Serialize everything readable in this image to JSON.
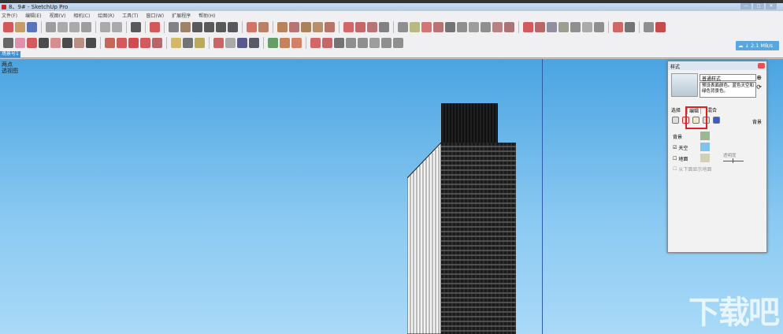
{
  "window": {
    "title": "8、9# - SketchUp Pro",
    "min": "—",
    "max": "◻",
    "close": "✕"
  },
  "menu": [
    "文件(F)",
    "编辑(E)",
    "视图(V)",
    "相机(C)",
    "绘图(R)",
    "工具(T)",
    "窗口(W)",
    "扩展程序",
    "帮助(H)"
  ],
  "toolbar1": [
    "#c33",
    "#b84",
    "#35a",
    "sep",
    "#888",
    "#999",
    "#999",
    "#888",
    "sep",
    "#999",
    "#999",
    "sep",
    "#333",
    "sep",
    "#c33",
    "sep",
    "#666",
    "#864",
    "#333",
    "#333",
    "#333",
    "#333",
    "sep",
    "#c54",
    "#a64",
    "sep",
    "#a63",
    "#a55",
    "#963",
    "#a74",
    "#a54",
    "sep",
    "#c44",
    "#b44",
    "#a55",
    "#666",
    "sep",
    "#777",
    "#aa6",
    "#c55",
    "#a55",
    "#555",
    "#777",
    "#888",
    "#777",
    "#a66",
    "#955",
    "sep",
    "#c33",
    "#a44",
    "#778",
    "#887",
    "#777",
    "#999",
    "#777",
    "sep",
    "#c44",
    "#555",
    "sep",
    "#777",
    "#b22"
  ],
  "toolbar2": [
    "#444",
    "#d79",
    "#c33",
    "#222",
    "#c77",
    "#222",
    "#a76",
    "#222",
    "sep",
    "#b43",
    "#c33",
    "#c22",
    "#c33",
    "#a44",
    "sep",
    "#ca4",
    "#555",
    "#a93",
    "sep",
    "#b44",
    "#999",
    "#337",
    "#334",
    "sep",
    "#484",
    "#b63",
    "#c64",
    "sep",
    "#c44",
    "#b44",
    "#555",
    "#777",
    "#777",
    "#888",
    "#777",
    "#777"
  ],
  "speed": {
    "icon": "cloud-icon",
    "text": "↓ 2.1 MB/s"
  },
  "scene_tab": "场景号1",
  "viewport": {
    "line1": "两点",
    "line2": "透视图"
  },
  "styles_panel": {
    "title": "样式",
    "name": "普通样式",
    "desc": "预设表面颜色。蓝色天空和绿色背景色。",
    "tabs": [
      "选择",
      "编辑",
      "混合"
    ],
    "section": "背景",
    "bg_label": "背景",
    "sky_label": "天空",
    "ground_label": "地面",
    "opacity_label": "透明度",
    "from_below": "从下面显示地面",
    "sky_checked": true,
    "ground_checked": false,
    "colors": {
      "bg": "#9bb894",
      "sky": "#7fc4ea",
      "ground": "#d3d0b4"
    }
  },
  "watermark": "下载吧"
}
